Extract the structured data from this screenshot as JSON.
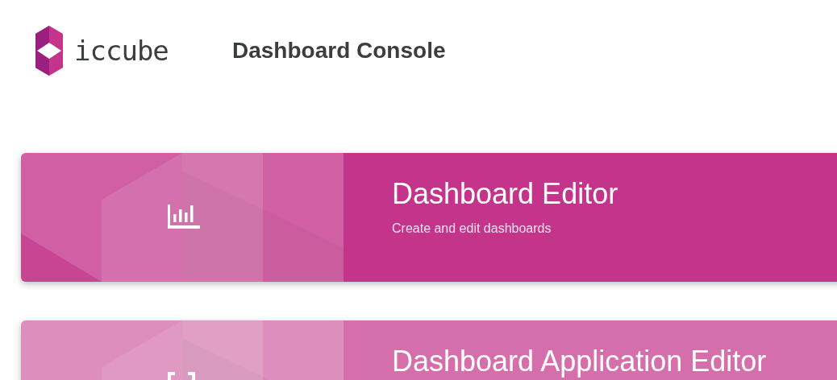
{
  "header": {
    "logo_text": "iccube",
    "title": "Dashboard Console"
  },
  "cards": [
    {
      "kind": "chart",
      "title": "Dashboard Editor",
      "subtitle": "Create and edit dashboards",
      "color": "#c3348a"
    },
    {
      "kind": "brackets",
      "title": "Dashboard Application Editor",
      "color": "#d46fab"
    }
  ]
}
